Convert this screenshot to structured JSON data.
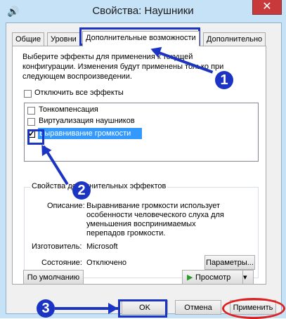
{
  "window": {
    "title": "Свойства: Наушники",
    "close_label": "✕"
  },
  "tabs": [
    {
      "label": "Общие"
    },
    {
      "label": "Уровни"
    },
    {
      "label": "Дополнительные возможности"
    },
    {
      "label": "Дополнительно"
    }
  ],
  "description": "Выберите эффекты для применения к текущей конфигурации. Изменения будут применены только при следующем воспроизведении.",
  "disable_all_label": "Отключить все эффекты",
  "effects": [
    {
      "label": "Тонкомпенсация",
      "checked": false
    },
    {
      "label": "Виртуализация наушников",
      "checked": false
    },
    {
      "label": "Выравнивание громкости",
      "checked": true
    }
  ],
  "properties": {
    "group_title": "Свойства дополнительных эффектов",
    "description_label": "Описание:",
    "description_text": "Выравнивание громкости использует особенности человеческого слуха для уменьшения воспринимаемых перепадов громкости.",
    "manufacturer_label": "Изготовитель:",
    "manufacturer_value": "Microsoft",
    "state_label": "Состояние:",
    "state_value": "Отключено",
    "params_button": "Параметры..."
  },
  "default_button": "По умолчанию",
  "preview_button": "Просмотр",
  "buttons": {
    "ok": "OK",
    "cancel": "Отмена",
    "apply": "Применить"
  },
  "markers": [
    "1",
    "2",
    "3"
  ],
  "colors": {
    "annotation": "#1c34c4",
    "apply_ring": "#e02020",
    "selection": "#3399ff"
  }
}
